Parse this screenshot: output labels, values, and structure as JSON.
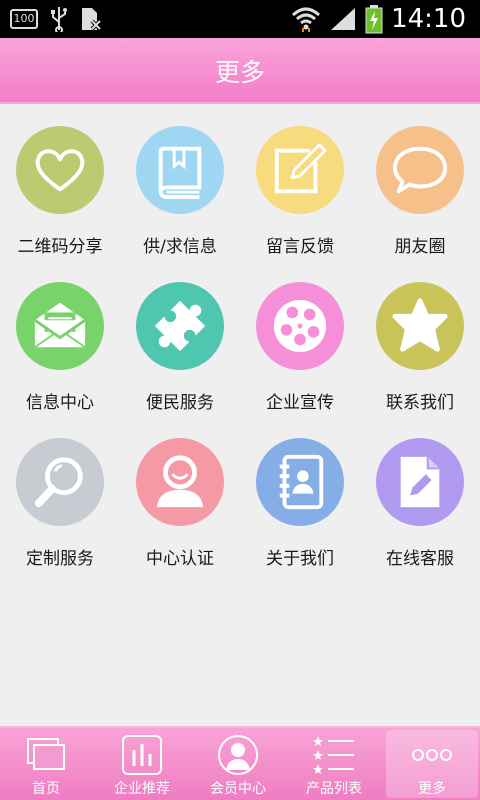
{
  "status_bar": {
    "battery_box_text": "100",
    "time": "14:10",
    "icons": [
      "battery-100-icon",
      "usb-icon",
      "sim-disabled-icon",
      "wifi-icon",
      "signal-icon",
      "battery-charging-icon"
    ]
  },
  "header": {
    "title": "更多"
  },
  "tiles": [
    {
      "label": "二维码分享",
      "icon": "heart-icon",
      "color": "#bccb72"
    },
    {
      "label": "供/求信息",
      "icon": "book-icon",
      "color": "#9fd7f2"
    },
    {
      "label": "留言反馈",
      "icon": "note-edit-icon",
      "color": "#f7dc7f"
    },
    {
      "label": "朋友圈",
      "icon": "speech-bubble-icon",
      "color": "#f6c08b"
    },
    {
      "label": "信息中心",
      "icon": "mail-icon",
      "color": "#79d36b"
    },
    {
      "label": "便民服务",
      "icon": "puzzle-icon",
      "color": "#4fc7b0"
    },
    {
      "label": "企业宣传",
      "icon": "film-reel-icon",
      "color": "#f58fd8"
    },
    {
      "label": "联系我们",
      "icon": "star-icon",
      "color": "#c8c45a"
    },
    {
      "label": "定制服务",
      "icon": "magnifier-icon",
      "color": "#c7ccd2"
    },
    {
      "label": "中心认证",
      "icon": "person-icon",
      "color": "#f59aa5"
    },
    {
      "label": "关于我们",
      "icon": "contact-book-icon",
      "color": "#86aee6"
    },
    {
      "label": "在线客服",
      "icon": "document-edit-icon",
      "color": "#b09af0"
    }
  ],
  "bottom_nav": [
    {
      "label": "首页",
      "icon": "windows-icon",
      "active": false
    },
    {
      "label": "企业推荐",
      "icon": "bar-chart-icon",
      "active": false
    },
    {
      "label": "会员中心",
      "icon": "user-icon",
      "active": false
    },
    {
      "label": "产品列表",
      "icon": "star-list-icon",
      "active": false
    },
    {
      "label": "更多",
      "icon": "more-dots-icon",
      "active": true
    }
  ]
}
